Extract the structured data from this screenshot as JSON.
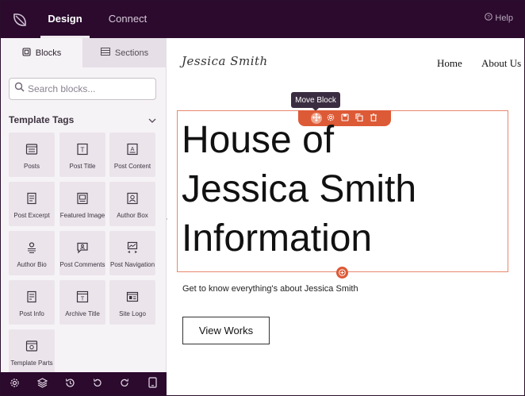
{
  "topbar": {
    "tabs": [
      {
        "label": "Design",
        "active": true
      },
      {
        "label": "Connect",
        "active": false
      }
    ],
    "help_label": "Help"
  },
  "sidebar": {
    "tabs": [
      {
        "label": "Blocks",
        "active": true,
        "icon": "blocks-icon"
      },
      {
        "label": "Sections",
        "active": false,
        "icon": "sections-icon"
      }
    ],
    "search": {
      "placeholder": "Search blocks...",
      "value": ""
    },
    "section_title": "Template Tags",
    "blocks": [
      {
        "label": "Posts",
        "icon": "posts-icon"
      },
      {
        "label": "Post Title",
        "icon": "post-title-icon"
      },
      {
        "label": "Post Content",
        "icon": "post-content-icon"
      },
      {
        "label": "Post Excerpt",
        "icon": "post-excerpt-icon"
      },
      {
        "label": "Featured Image",
        "icon": "featured-image-icon"
      },
      {
        "label": "Author Box",
        "icon": "author-box-icon"
      },
      {
        "label": "Author Bio",
        "icon": "author-bio-icon"
      },
      {
        "label": "Post Comments",
        "icon": "post-comments-icon"
      },
      {
        "label": "Post Navigation",
        "icon": "post-navigation-icon"
      },
      {
        "label": "Post Info",
        "icon": "post-info-icon"
      },
      {
        "label": "Archive Title",
        "icon": "archive-title-icon"
      },
      {
        "label": "Site Logo",
        "icon": "site-logo-icon"
      },
      {
        "label": "Template Parts",
        "icon": "template-parts-icon"
      }
    ]
  },
  "bottombar": {
    "buttons": [
      "settings-icon",
      "layers-icon",
      "history-icon",
      "undo-icon",
      "redo-icon",
      "device-preview-icon"
    ]
  },
  "canvas": {
    "site_logo": "Jessica Smith",
    "nav": [
      "Home",
      "About Us"
    ],
    "tooltip": "Move Block",
    "heading_lines": [
      "House of",
      "Jessica Smith",
      "Information"
    ],
    "subtext": "Get to know everything's about Jessica Smith",
    "cta_label": "View Works"
  },
  "colors": {
    "topbar_bg": "#2b0a2e",
    "accent": "#dd5a36",
    "sidebar_bg": "#f6f3f6",
    "tile_bg": "#ebe5eb"
  }
}
